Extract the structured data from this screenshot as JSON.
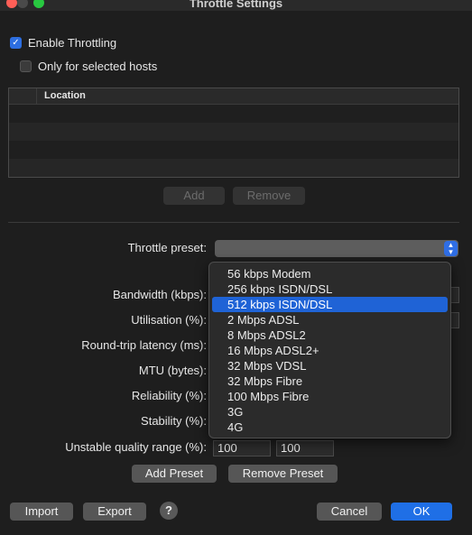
{
  "window": {
    "title": "Throttle Settings",
    "traffic_lights": [
      "close",
      "minimize",
      "zoom"
    ]
  },
  "options": {
    "enable_throttling": {
      "label": "Enable Throttling",
      "checked": true
    },
    "only_selected_hosts": {
      "label": "Only for selected hosts",
      "checked": false
    }
  },
  "hosts_table": {
    "column_header": "Location",
    "rows": []
  },
  "hosts_buttons": {
    "add": "Add",
    "remove": "Remove"
  },
  "preset": {
    "label": "Throttle preset:",
    "value": "",
    "options": [
      "56 kbps Modem",
      "256 kbps ISDN/DSL",
      "512 kbps ISDN/DSL",
      "2 Mbps ADSL",
      "8 Mbps ADSL2",
      "16 Mbps ADSL2+",
      "32 Mbps VDSL",
      "32 Mbps Fibre",
      "100 Mbps Fibre",
      "3G",
      "4G"
    ],
    "highlighted": "512 kbps ISDN/DSL"
  },
  "fields": {
    "bandwidth": {
      "label": "Bandwidth (kbps):"
    },
    "utilisation": {
      "label": "Utilisation (%):"
    },
    "latency": {
      "label": "Round-trip latency (ms):"
    },
    "mtu": {
      "label": "MTU (bytes):"
    },
    "reliability": {
      "label": "Reliability (%):"
    },
    "stability": {
      "label": "Stability (%):"
    },
    "unstable_range": {
      "label": "Unstable quality range (%):",
      "min": "100",
      "max": "100"
    }
  },
  "preset_buttons": {
    "add": "Add Preset",
    "remove": "Remove Preset"
  },
  "footer": {
    "import": "Import",
    "export": "Export",
    "help": "?",
    "cancel": "Cancel",
    "ok": "OK"
  },
  "colors": {
    "background": "#1e1e1e",
    "accent": "#1f6fe6",
    "close": "#ff5f57",
    "minimize": "#febc2e",
    "zoom": "#28c840"
  }
}
